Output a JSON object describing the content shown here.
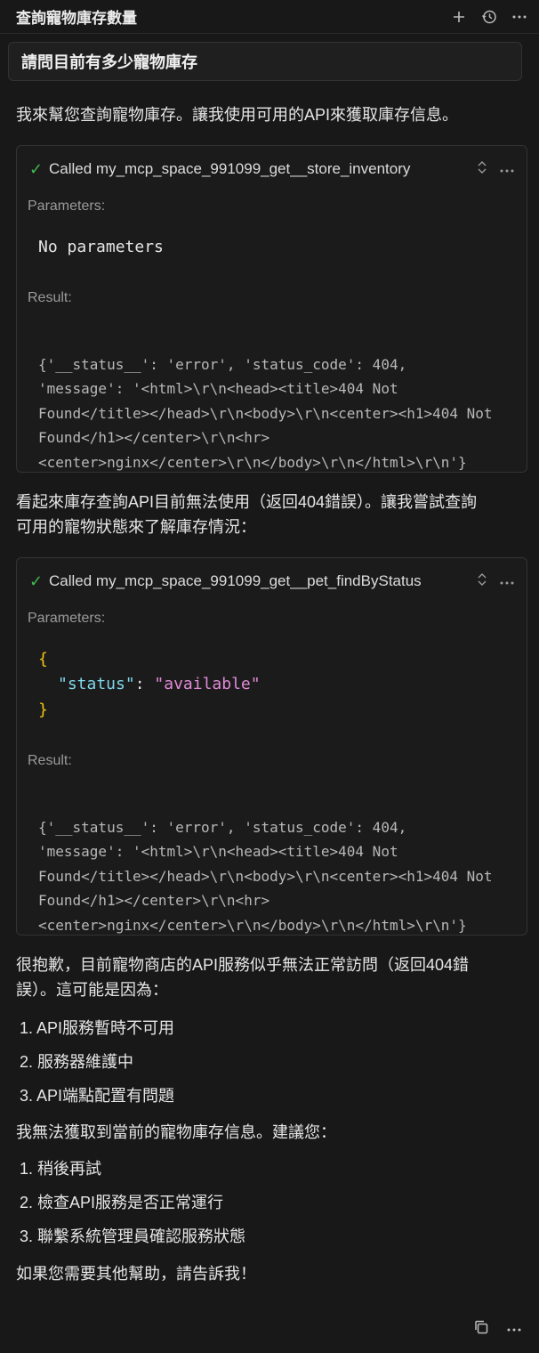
{
  "header": {
    "title": "查詢寵物庫存數量",
    "icons": [
      "plus-icon",
      "history-icon",
      "more-icon"
    ]
  },
  "user_message": "請問目前有多少寵物庫存",
  "assistant": {
    "intro": "我來幫您查詢寵物庫存。讓我使用可用的API來獲取庫存信息。",
    "tool1": {
      "name": "Called my_mcp_space_991099_get__store_inventory",
      "parameters_label": "Parameters:",
      "parameters_text": "No parameters",
      "result_label": "Result:",
      "result_lines": [
        "{'__status__': 'error', 'status_code': 404,",
        "'message': '<html>\\r\\n<head><title>404 Not",
        "Found</title></head>\\r\\n<body>\\r\\n<center><h1>404 Not",
        "Found</h1></center>\\r\\n<hr>",
        "<center>nginx</center>\\r\\n</body>\\r\\n</html>\\r\\n'}"
      ]
    },
    "middle_lines": [
      "看起來庫存查詢API目前無法使用（返回404錯誤）。讓我嘗試查詢",
      "可用的寵物狀態來了解庫存情況："
    ],
    "tool2": {
      "name": "Called my_mcp_space_991099_get__pet_findByStatus",
      "parameters_label": "Parameters:",
      "json_open": "{",
      "json_key": "\"status\"",
      "json_colon": ": ",
      "json_value": "\"available\"",
      "json_close": "}",
      "result_label": "Result:",
      "result_lines": [
        "{'__status__': 'error', 'status_code': 404,",
        "'message': '<html>\\r\\n<head><title>404 Not",
        "Found</title></head>\\r\\n<body>\\r\\n<center><h1>404 Not",
        "Found</h1></center>\\r\\n<hr>",
        "<center>nginx</center>\\r\\n</body>\\r\\n</html>\\r\\n'}"
      ]
    },
    "sorry_lines": [
      "很抱歉，目前寵物商店的API服務似乎無法正常訪問（返回404錯",
      "誤）。這可能是因為："
    ],
    "reasons": [
      "1. API服務暫時不可用",
      "2. 服務器維護中",
      "3. API端點配置有問題"
    ],
    "suggest_intro": "我無法獲取到當前的寵物庫存信息。建議您：",
    "suggestions": [
      "1. 稍後再試",
      "2. 檢查API服務是否正常運行",
      "3. 聯繫系統管理員確認服務狀態"
    ],
    "closing": "如果您需要其他幫助，請告訴我！"
  },
  "footer": {
    "icons": [
      "copy-icon",
      "more-icon"
    ]
  }
}
